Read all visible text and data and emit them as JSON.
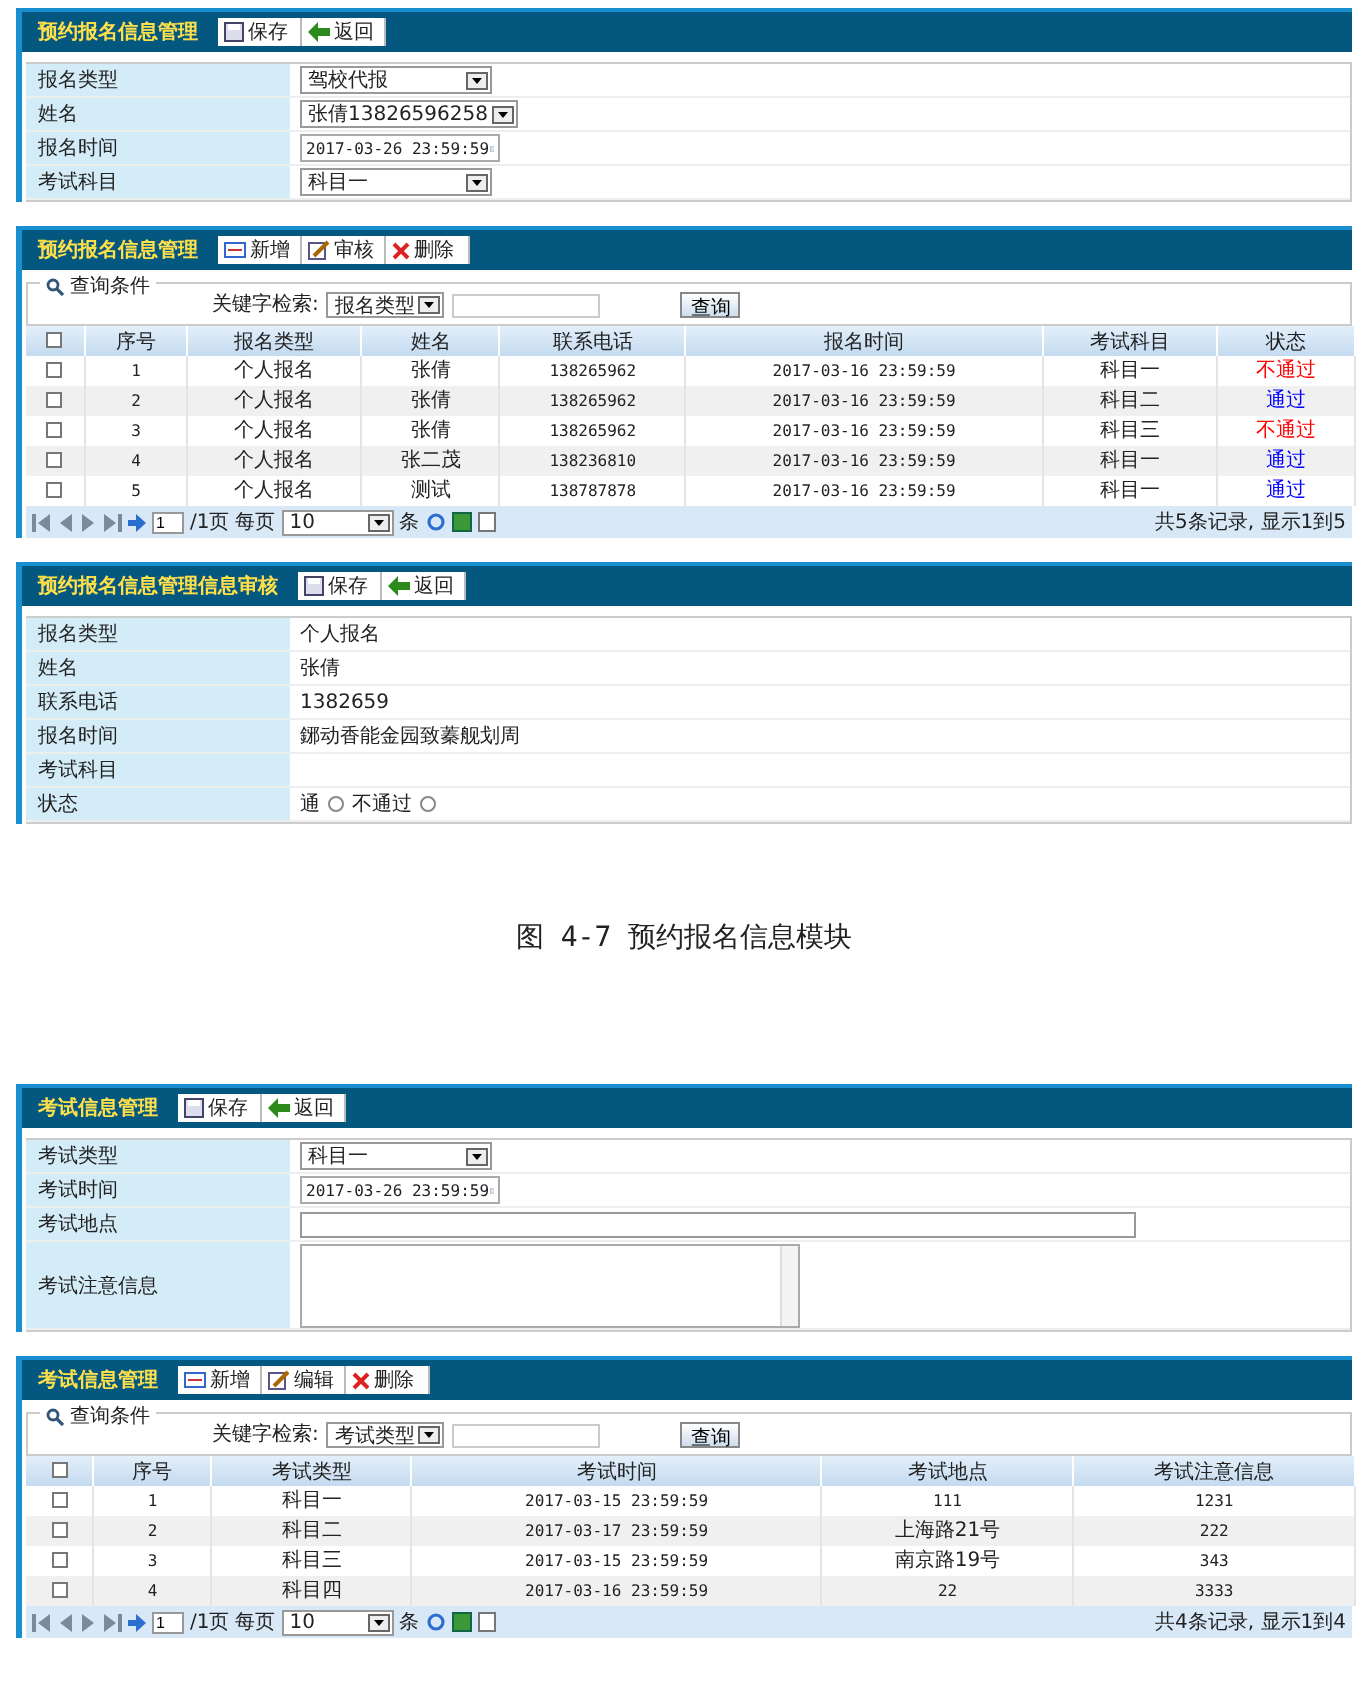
{
  "sections": [
    {
      "kind": "form",
      "title": "预约报名信息管理",
      "buttons": [
        {
          "label": "保存"
        },
        {
          "label": "返回"
        }
      ],
      "fields": [
        {
          "label": "报名类型",
          "kind": "select",
          "value": "驾校代报"
        },
        {
          "label": "姓名",
          "kind": "select",
          "value": "张倩13826596258"
        },
        {
          "label": "报名时间",
          "kind": "date",
          "value": "2017-03-26 23:59:59"
        },
        {
          "label": "考试科目",
          "kind": "select",
          "value": "科目一"
        }
      ]
    },
    {
      "kind": "grid",
      "title": "预约报名信息管理",
      "buttons": [
        {
          "label": "新增"
        },
        {
          "label": "审核"
        },
        {
          "label": "删除"
        }
      ],
      "legend": "查询条件",
      "search_label": "关键字检索:",
      "search_select": "报名类型",
      "search_button": "查询",
      "select_all_checked": false,
      "columns": [
        "序号",
        "报名类型",
        "姓名",
        "联系电话",
        "报名时间",
        "考试科目",
        "状态"
      ],
      "rows": [
        {
          "checked": false,
          "cells": [
            "1",
            "个人报名",
            "张倩",
            "138265962",
            "2017-03-16 23:59:59",
            "科目一"
          ],
          "status": {
            "text": "不通过",
            "color": "#ff0000"
          }
        },
        {
          "checked": false,
          "cells": [
            "2",
            "个人报名",
            "张倩",
            "138265962",
            "2017-03-16 23:59:59",
            "科目二"
          ],
          "status": {
            "text": "通过",
            "color": "#0000ff"
          }
        },
        {
          "checked": false,
          "cells": [
            "3",
            "个人报名",
            "张倩",
            "138265962",
            "2017-03-16 23:59:59",
            "科目三"
          ],
          "status": {
            "text": "不通过",
            "color": "#ff0000"
          }
        },
        {
          "checked": false,
          "cells": [
            "4",
            "个人报名",
            "张二茂",
            "138236810",
            "2017-03-16 23:59:59",
            "科目一"
          ],
          "status": {
            "text": "通过",
            "color": "#0000ff"
          }
        },
        {
          "checked": false,
          "cells": [
            "5",
            "个人报名",
            "测试",
            "138787878",
            "2017-03-16 23:59:59",
            "科目一"
          ],
          "status": {
            "text": "通过",
            "color": "#0000ff"
          }
        }
      ],
      "pager": {
        "page": "1",
        "pages": "/1页",
        "per_page": "每页",
        "size": "10",
        "unit": "条",
        "summary": "共5条记录, 显示1到5"
      }
    },
    {
      "kind": "form",
      "title": "预约报名信息管理信息审核",
      "buttons": [
        {
          "label": "保存"
        },
        {
          "label": "返回"
        }
      ],
      "fields": [
        {
          "label": "报名类型",
          "kind": "static",
          "value": "个人报名"
        },
        {
          "label": "姓名",
          "kind": "static",
          "value": "张倩"
        },
        {
          "label": "联系电话",
          "kind": "static",
          "value": "1382659"
        },
        {
          "label": "报名时间",
          "kind": "static",
          "value": "鋣动香能金园致蓁舰划周"
        },
        {
          "label": "考试科目",
          "kind": "static"
        },
        {
          "label": "状态",
          "kind": "radio",
          "options": [
            {
              "label": "通",
              "selected": false
            },
            {
              "label": "不通过",
              "selected": false
            }
          ]
        }
      ]
    },
    {
      "kind": "caption",
      "text": "图 4-7  预约报名信息模块"
    },
    {
      "kind": "form",
      "title": "考试信息管理",
      "buttons": [
        {
          "label": "保存"
        },
        {
          "label": "返回"
        }
      ],
      "fields": [
        {
          "label": "考试类型",
          "kind": "select",
          "value": "科目一"
        },
        {
          "label": "考试时间",
          "kind": "date",
          "value": "2017-03-26 23:59:59"
        },
        {
          "label": "考试地点",
          "kind": "text"
        },
        {
          "label": "考试注意信息",
          "kind": "textarea"
        }
      ]
    },
    {
      "kind": "grid",
      "title": "考试信息管理",
      "buttons": [
        {
          "label": "新增"
        },
        {
          "label": "编辑"
        },
        {
          "label": "删除"
        }
      ],
      "legend": "查询条件",
      "search_label": "关键字检索:",
      "search_select": "考试类型",
      "search_button": "查询",
      "select_all_checked": false,
      "columns": [
        "序号",
        "考试类型",
        "考试时间",
        "考试地点",
        "考试注意信息"
      ],
      "rows": [
        {
          "checked": false,
          "cells": [
            "1",
            "科目一",
            "2017-03-15 23:59:59",
            "111",
            "1231"
          ]
        },
        {
          "checked": false,
          "cells": [
            "2",
            "科目二",
            "2017-03-17 23:59:59",
            "上海路21号",
            "222"
          ]
        },
        {
          "checked": false,
          "cells": [
            "3",
            "科目三",
            "2017-03-15 23:59:59",
            "南京路19号",
            "343"
          ]
        },
        {
          "checked": false,
          "cells": [
            "4",
            "科目四",
            "2017-03-16 23:59:59",
            "22",
            "3333"
          ]
        }
      ],
      "pager": {
        "page": "1",
        "pages": "/1页",
        "per_page": "每页",
        "size": "10",
        "unit": "条",
        "summary": "共4条记录, 显示1到4"
      }
    }
  ]
}
